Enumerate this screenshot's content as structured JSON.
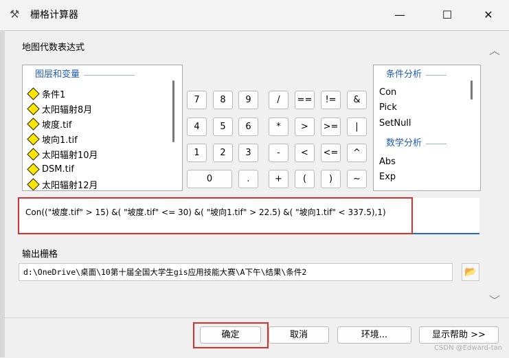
{
  "window": {
    "title": "栅格计算器",
    "icon": "hammer-icon",
    "minimize": "—",
    "maximize": "☐",
    "close": "✕"
  },
  "expression_label": "地图代数表达式",
  "layers": {
    "header": "图层和变量",
    "items": [
      "条件1",
      "太阳辐射8月",
      "坡度.tif",
      "坡向1.tif",
      "太阳辐射10月",
      "DSM.tif",
      "太阳辐射12月"
    ]
  },
  "functions": {
    "conditional_header": "条件分析",
    "conditional": [
      "Con",
      "Pick",
      "SetNull"
    ],
    "math_header": "数学分析",
    "math": [
      "Abs",
      "Exp"
    ]
  },
  "keypad": [
    [
      "7",
      "8",
      "9",
      "/",
      "==",
      "!=",
      "&"
    ],
    [
      "4",
      "5",
      "6",
      "*",
      ">",
      ">=",
      "|"
    ],
    [
      "1",
      "2",
      "3",
      "-",
      "<",
      "<=",
      "^"
    ],
    [
      "0",
      ".",
      "+",
      "(",
      ")",
      "~"
    ]
  ],
  "expression": "Con((\"坡度.tif\" > 15) &( \"坡度.tif\" <= 30) &( \"坡向1.tif\" > 22.5) &( \"坡向1.tif\" < 337.5),1)",
  "output": {
    "label": "输出栅格",
    "path": "d:\\OneDrive\\桌面\\10第十届全国大学生gis应用技能大赛\\A下午\\结果\\条件2"
  },
  "buttons": {
    "ok": "确定",
    "cancel": "取消",
    "environments": "环境...",
    "show_help": "显示帮助 >>"
  },
  "watermark": "CSDN @Edward-tan",
  "colors": {
    "highlight_red": "#d83030",
    "header_blue": "#1f5bb5",
    "input_underline": "#2a66c8"
  }
}
